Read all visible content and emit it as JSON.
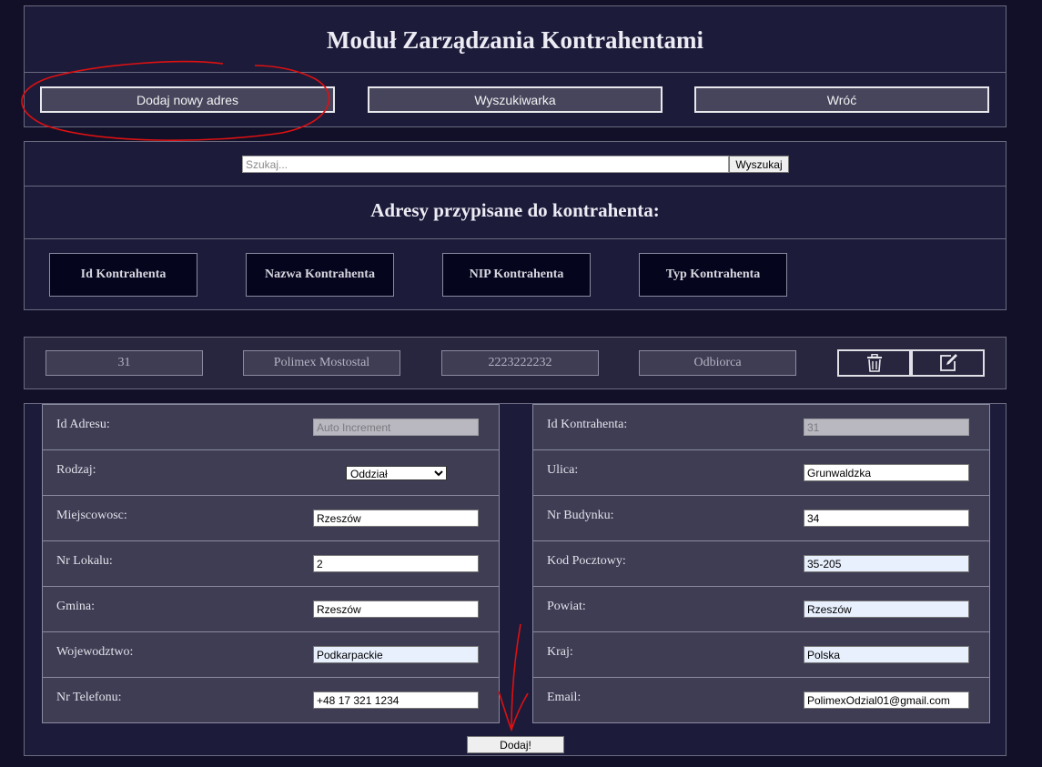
{
  "header": {
    "title": "Moduł Zarządzania Kontrahentami"
  },
  "nav": {
    "add_address": "Dodaj nowy adres",
    "search_tool": "Wyszukiwarka",
    "back": "Wróć"
  },
  "search": {
    "placeholder": "Szukaj...",
    "button": "Wyszukaj"
  },
  "section_title": "Adresy przypisane do kontrahenta:",
  "columns": [
    "Id Kontrahenta",
    "Nazwa Kontrahenta",
    "NIP Kontrahenta",
    "Typ Kontrahenta"
  ],
  "row": {
    "id": "31",
    "name": "Polimex Mostostal",
    "nip": "2223222232",
    "type": "Odbiorca",
    "actions": {
      "delete_icon": "trash-icon",
      "edit_icon": "edit-icon"
    }
  },
  "form": {
    "left": [
      {
        "label": "Id Adresu:",
        "value": "",
        "placeholder": "Auto Increment"
      },
      {
        "label": "Rodzaj:",
        "value": "Oddział"
      },
      {
        "label": "Miejscowosc:",
        "value": "Rzeszów"
      },
      {
        "label": "Nr Lokalu:",
        "value": "2"
      },
      {
        "label": "Gmina:",
        "value": "Rzeszów"
      },
      {
        "label": "Wojewodztwo:",
        "value": "Podkarpackie"
      },
      {
        "label": "Nr Telefonu:",
        "value": "+48 17 321 1234"
      }
    ],
    "right": [
      {
        "label": "Id Kontrahenta:",
        "value": "31"
      },
      {
        "label": "Ulica:",
        "value": "Grunwaldzka"
      },
      {
        "label": "Nr Budynku:",
        "value": "34"
      },
      {
        "label": "Kod Pocztowy:",
        "value": "35-205"
      },
      {
        "label": "Powiat:",
        "value": "Rzeszów"
      },
      {
        "label": "Kraj:",
        "value": "Polska"
      },
      {
        "label": "Email:",
        "value": "PolimexOdzial01@gmail.com"
      }
    ],
    "submit": "Dodaj!"
  },
  "colors": {
    "page_bg": "#111028",
    "panel_bg": "#1c1b3a",
    "annotation": "#dd1111"
  }
}
